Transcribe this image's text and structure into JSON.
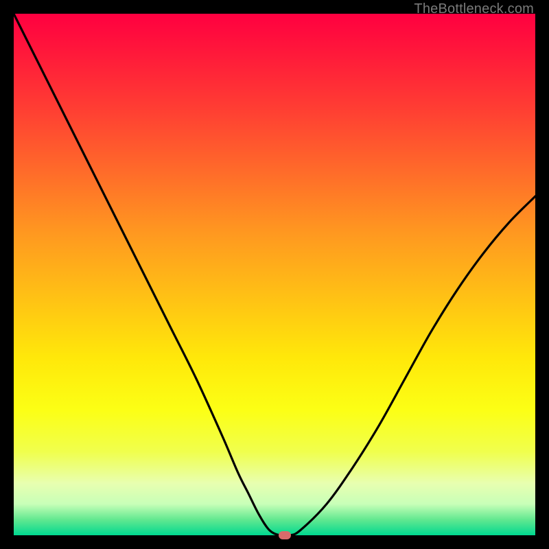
{
  "watermark": "TheBottleneck.com",
  "chart_data": {
    "type": "line",
    "title": "",
    "xlabel": "",
    "ylabel": "",
    "xlim": [
      0,
      100
    ],
    "ylim": [
      0,
      100
    ],
    "grid": false,
    "legend": false,
    "series": [
      {
        "name": "bottleneck-curve",
        "x": [
          0,
          5,
          10,
          15,
          20,
          25,
          30,
          35,
          40,
          43,
          45,
          47,
          49,
          51,
          53,
          55,
          60,
          65,
          70,
          75,
          80,
          85,
          90,
          95,
          100
        ],
        "values": [
          100,
          90,
          80,
          70,
          60,
          50,
          40,
          30,
          19,
          12,
          8,
          4,
          1,
          0,
          0,
          1,
          6,
          13,
          21,
          30,
          39,
          47,
          54,
          60,
          65
        ]
      }
    ],
    "marker": {
      "x": 52,
      "y": 0,
      "color": "#d96b6b"
    },
    "background_gradient": [
      {
        "pos": 0,
        "color": "#ff0040"
      },
      {
        "pos": 50,
        "color": "#ffc015"
      },
      {
        "pos": 80,
        "color": "#fcff15"
      },
      {
        "pos": 100,
        "color": "#00d890"
      }
    ]
  }
}
